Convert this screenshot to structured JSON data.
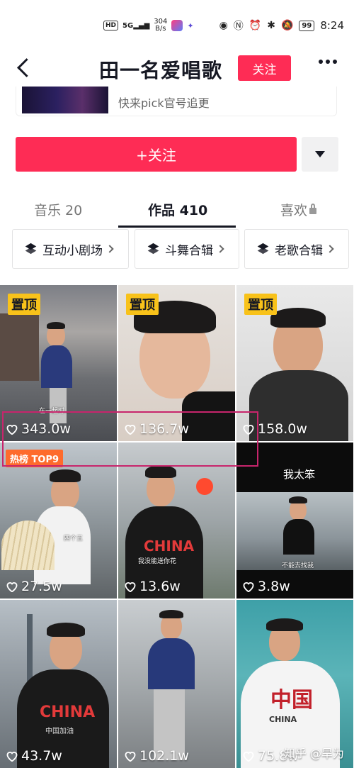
{
  "status_bar": {
    "network_tag": "HD",
    "signal": "5G",
    "speed_value": "304",
    "speed_unit": "B/s",
    "time": "8:24",
    "battery": "99"
  },
  "header": {
    "title": "田一名爱唱歌",
    "follow_label": "关注"
  },
  "pick_card": {
    "text": "快来pick官号追更"
  },
  "follow_button": {
    "label": "+关注"
  },
  "tabs": [
    {
      "label": "音乐 20"
    },
    {
      "label": "作品 410"
    },
    {
      "label": "喜欢"
    }
  ],
  "collections": [
    {
      "label": "互动小剧场"
    },
    {
      "label": "斗舞合辑"
    },
    {
      "label": "老歌合辑"
    }
  ],
  "videos": [
    {
      "likes": "343.0w",
      "badge": "置顶",
      "caption": "在一起时..."
    },
    {
      "likes": "136.7w",
      "badge": "置顶"
    },
    {
      "likes": "158.0w",
      "badge": "置顶"
    },
    {
      "likes": "27.5w",
      "badge": "热榜 TOP9",
      "caption": "四个五"
    },
    {
      "likes": "13.6w",
      "shirt_text": "CHINA",
      "caption": "我没能送你花"
    },
    {
      "likes": "3.8w",
      "overlay_title": "我太笨",
      "caption": "不能去找我"
    },
    {
      "likes": "43.7w",
      "shirt_text": "CHINA",
      "shirt_sub": "中国加油"
    },
    {
      "likes": "102.1w"
    },
    {
      "likes": "75.8w",
      "shirt_text": "CHINA",
      "shirt_sub": "中国"
    }
  ],
  "watermark": "知乎 @旱为",
  "colors": {
    "accent": "#fe2c55",
    "badge_yellow": "#f8c21a",
    "hot_orange": "#fe6b2c",
    "highlight": "#c8256c"
  }
}
